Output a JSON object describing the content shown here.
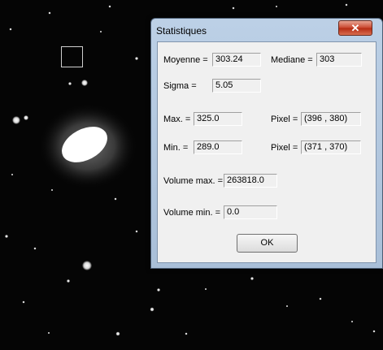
{
  "window": {
    "title": "Statistiques",
    "close_glyph": "✕"
  },
  "stats": {
    "mean_label": "Moyenne =",
    "mean_value": "303.24",
    "median_label": "Mediane =",
    "median_value": "303",
    "sigma_label": "Sigma =",
    "sigma_value": "5.05",
    "max_label": "Max. =",
    "max_value": "325.0",
    "max_pixel_label": "Pixel =",
    "max_pixel_value": "(396 , 380)",
    "min_label": "Min. =",
    "min_value": "289.0",
    "min_pixel_label": "Pixel =",
    "min_pixel_value": "(371 , 370)",
    "volume_max_label": "Volume max. =",
    "volume_max_value": "263818.0",
    "volume_min_label": "Volume min. =",
    "volume_min_value": "0.0"
  },
  "buttons": {
    "ok_label": "OK"
  },
  "icons": {
    "close": "close-icon"
  },
  "colors": {
    "titlebar": "#bcd0e6",
    "close_button": "#c9452d",
    "dialog_body": "#f0f0f0"
  }
}
